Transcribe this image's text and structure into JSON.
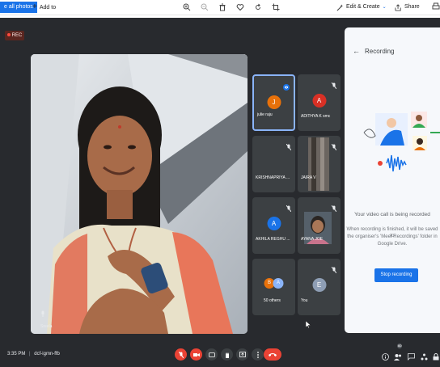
{
  "viewer": {
    "see_all_label": "e all photos",
    "add_to_label": "Add to",
    "edit_create_label": "Edit & Create",
    "share_label": "Share"
  },
  "meeting": {
    "rec_label": "REC",
    "time": "3:35 PM",
    "separator": "|",
    "code": "dcf-igmn-ffb",
    "main_tile_name": "Sreela"
  },
  "participants": [
    {
      "name": "julie raju",
      "initial": "J",
      "color": "#e8710a"
    },
    {
      "name": "ADITHYA K smc",
      "initial": "A",
      "color": "#d93025"
    },
    {
      "name": "KRISHNAPRIYA ...",
      "initial": "",
      "color": ""
    },
    {
      "name": "JAIRA V",
      "initial": "",
      "color": ""
    },
    {
      "name": "AKHILA REGHU ...",
      "initial": "A",
      "color": "#1a73e8"
    },
    {
      "name": "AYANA JOE",
      "initial": "",
      "color": ""
    },
    {
      "name": "50 others",
      "initial": "B",
      "color": "#e8710a"
    },
    {
      "name": "You",
      "initial": "E",
      "color": "#8e9eb5"
    }
  ],
  "sidepanel": {
    "title": "Recording",
    "message_title": "Your video call is being recorded",
    "message_body_1": "When recording is finished, it will be saved to",
    "message_body_2": "the organiser's 'Meet Recordings' folder in",
    "message_body_3": "Google Drive.",
    "stop_label": "Stop recording"
  },
  "badge_count": "60"
}
